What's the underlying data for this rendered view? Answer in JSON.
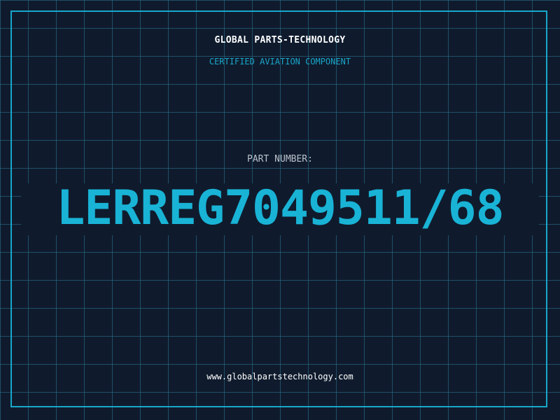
{
  "header": {
    "company": "GLOBAL PARTS-TECHNOLOGY",
    "subtitle": "CERTIFIED AVIATION COMPONENT"
  },
  "part": {
    "label": "PART NUMBER:",
    "value": "LERREG7049511/68"
  },
  "footer": {
    "website": "www.globalpartstechnology.com"
  },
  "colors": {
    "background": "#0f1b2d",
    "grid": "#2e7896",
    "accent": "#19a6c9",
    "text": "#ffffff",
    "label": "#b9c2cc"
  }
}
